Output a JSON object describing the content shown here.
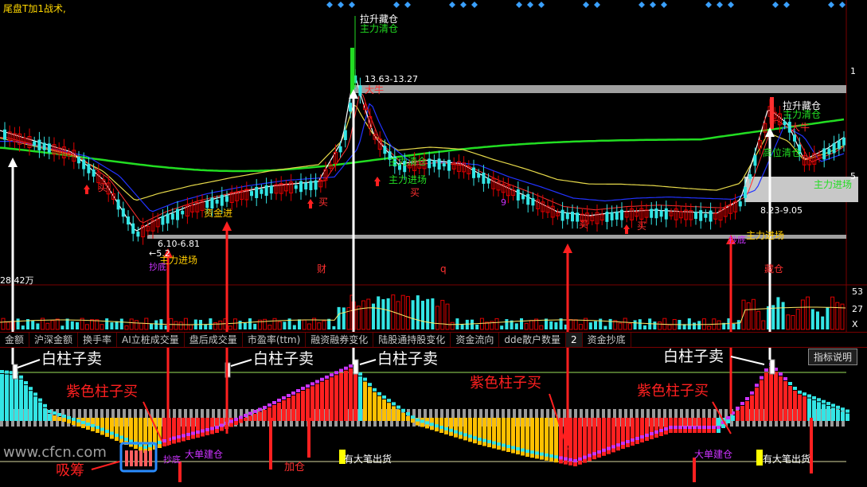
{
  "title": "尾盘T加1战术,",
  "tabs": [
    "金额",
    "沪深金额",
    "换手率",
    "AI立桩成交量",
    "盘后成交量",
    "市盈率(ttm)",
    "融资融券变化",
    "陆股通持股变化",
    "资金流向",
    "dde散户数量",
    "2",
    "资金抄底"
  ],
  "help_button": "指标说明",
  "volume_label": "28.42万",
  "right_axis": {
    "top": "1",
    "mid": "5",
    "vol_hi": "53",
    "vol_mid": "27",
    "vol_lo": "X"
  },
  "price_labels": {
    "range1": "13.63-13.27",
    "range2": "6.10-6.81",
    "range3": "8.23-9.05",
    "range1_x": "←",
    "range2_low": "←5.2"
  },
  "signals": {
    "pull_up_hold": "拉升藏仓",
    "main_clear": "主力清仓",
    "big_bull": "大牛",
    "main_enter": "主力进场",
    "buy": "买",
    "capital_enter": "资金进",
    "big_order_in": "大单建仓",
    "big_order_out": "有大笔出货",
    "add_position": "加仓",
    "bottom": "抄底",
    "cai": "财",
    "q": "q",
    "top_cang": "藏仓",
    "nine": "9",
    "gao_qing": "高位清仓"
  },
  "annotations": {
    "white_sell": "白柱子卖",
    "purple_buy": "紫色柱子买",
    "absorb": "吸筹",
    "watermark": "www.cfcn.com"
  },
  "colors": {
    "bg": "#000000",
    "up": "#e00000",
    "down": "#33e5e5",
    "ma_green": "#22dd22",
    "ma_yellow": "#e6d94a",
    "ma_blue": "#2233ff",
    "ma_red": "#ff3030",
    "grey": "#9a9a9a",
    "purple": "#cc33ff",
    "orange": "#ffc000",
    "arrow_red": "#ff2020"
  }
}
